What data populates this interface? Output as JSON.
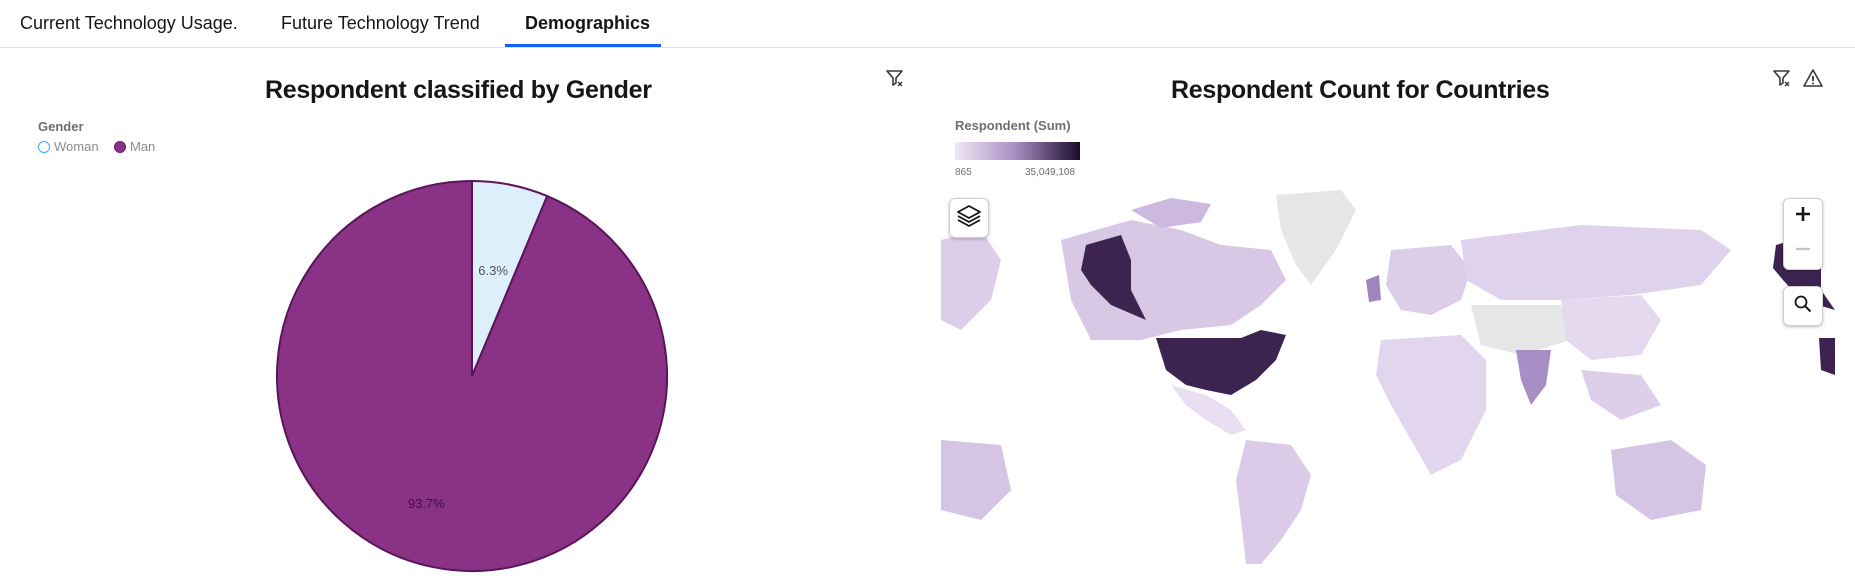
{
  "tabs": [
    {
      "label": "Current Technology Usage."
    },
    {
      "label": "Future Technology Trend"
    },
    {
      "label": "Demographics"
    }
  ],
  "gender_panel": {
    "title": "Respondent classified by Gender",
    "legend_title": "Gender",
    "legend": [
      {
        "label": "Woman",
        "color": "#d9eefb",
        "stroke": "#33b1ff"
      },
      {
        "label": "Man",
        "color": "#8a3386",
        "stroke": "#6a1b6a"
      }
    ]
  },
  "chart_data": {
    "type": "pie",
    "title": "Respondent classified by Gender",
    "legend_title": "Gender",
    "legend_position": "top-left",
    "slices": [
      {
        "label": "Woman",
        "value": 6.3,
        "display": "6.3%",
        "color": "#dceffa"
      },
      {
        "label": "Man",
        "value": 93.7,
        "display": "93.7%",
        "color": "#8a3386"
      }
    ]
  },
  "map_panel": {
    "title": "Respondent Count for Countries",
    "legend_title": "Respondent (Sum)",
    "scale_min": "865",
    "scale_max": "35,049,108",
    "colors": {
      "low": "#f1e7f6",
      "mid": "#a48bbf",
      "high": "#1b0a2e",
      "no_data": "#e6e6e6"
    }
  },
  "icons": {
    "filter": "filter-icon",
    "warning": "warning-icon",
    "layers": "layers-icon",
    "zoom_in": "plus-icon",
    "zoom_out": "minus-icon",
    "search": "search-icon"
  }
}
